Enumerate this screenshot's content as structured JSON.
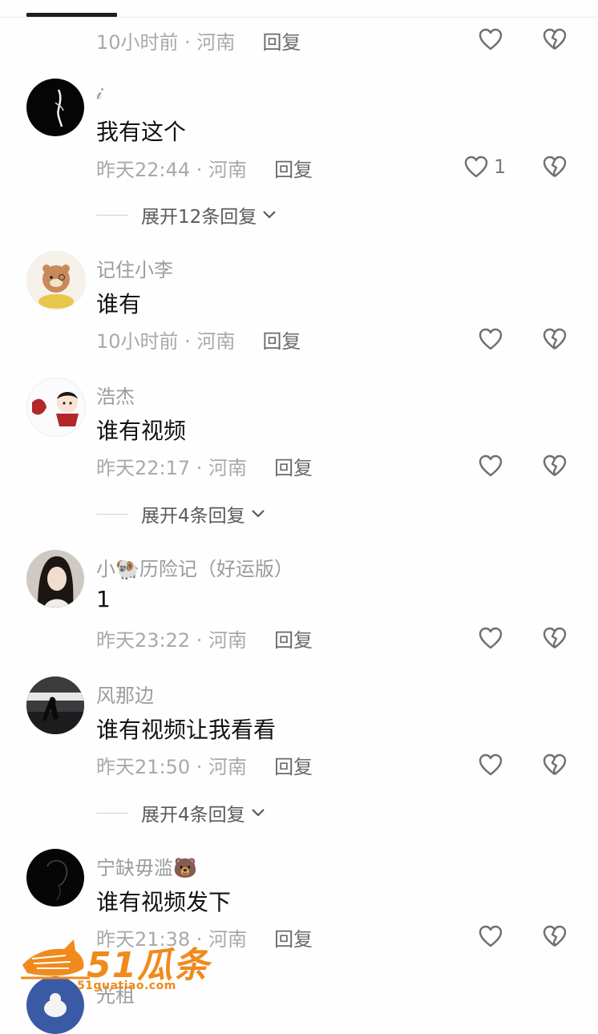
{
  "colors": {
    "accent_watermark": "#f08a1c",
    "meta_gray": "#a9a9a9",
    "reply_gray": "#6a6a6a"
  },
  "top_comment_partial": {
    "time": "10小时前 · 河南",
    "reply": "回复"
  },
  "comments": [
    {
      "username": "𝒾",
      "text": "我有这个",
      "time": "昨天22:44 · 河南",
      "reply": "回复",
      "likes": "1",
      "expand": "展开12条回复"
    },
    {
      "username": "记住小李",
      "text": "谁有",
      "time": "10小时前 · 河南",
      "reply": "回复"
    },
    {
      "username": "浩杰",
      "text": "谁有视频",
      "time": "昨天22:17 · 河南",
      "reply": "回复",
      "expand": "展开4条回复"
    },
    {
      "username": "小🐏历险记（好运版）",
      "text": "1",
      "time": "昨天23:22 · 河南",
      "reply": "回复"
    },
    {
      "username": "风那边",
      "text": "谁有视频让我看看",
      "time": "昨天21:50 · 河南",
      "reply": "回复",
      "expand": "展开4条回复"
    },
    {
      "username": "宁缺毋滥🐻",
      "text": "谁有视频发下",
      "time": "昨天21:38 · 河南",
      "reply": "回复"
    },
    {
      "username": "光租"
    }
  ],
  "watermark": {
    "logo_text": "51瓜条",
    "url": "51guatiao.com"
  },
  "icons": {
    "like": "heart-outline-icon",
    "dislike": "broken-heart-icon",
    "expand": "chevron-down-icon"
  }
}
